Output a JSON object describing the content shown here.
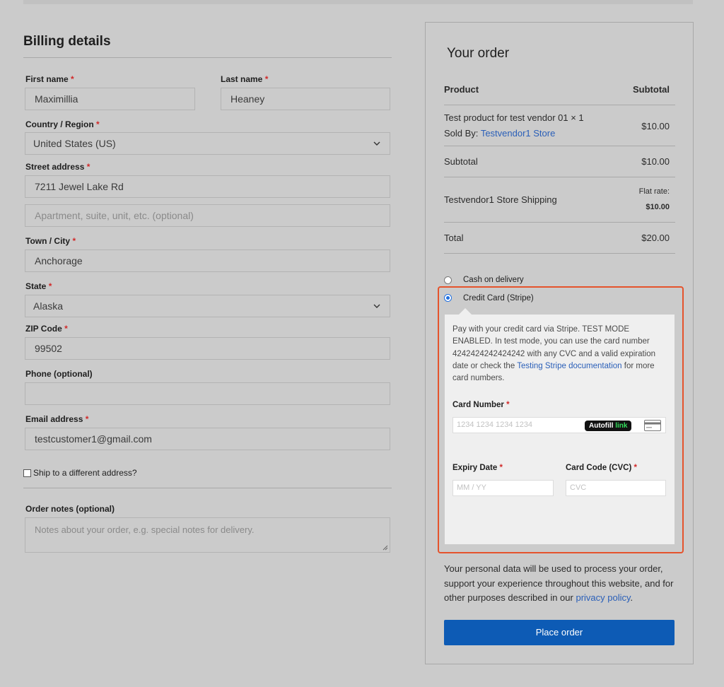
{
  "billing": {
    "title": "Billing details",
    "first_name": {
      "label": "First name",
      "value": "Maximillia"
    },
    "last_name": {
      "label": "Last name",
      "value": "Heaney"
    },
    "country": {
      "label": "Country / Region",
      "value": "United States (US)"
    },
    "street": {
      "label": "Street address",
      "value": "7211 Jewel Lake Rd",
      "placeholder2": "Apartment, suite, unit, etc. (optional)"
    },
    "city": {
      "label": "Town / City",
      "value": "Anchorage"
    },
    "state": {
      "label": "State",
      "value": "Alaska"
    },
    "zip": {
      "label": "ZIP Code",
      "value": "99502"
    },
    "phone": {
      "label": "Phone (optional)",
      "value": ""
    },
    "email": {
      "label": "Email address",
      "value": "testcustomer1@gmail.com"
    },
    "ship_different": "Ship to a different address?",
    "notes": {
      "label": "Order notes (optional)",
      "placeholder": "Notes about your order, e.g. special notes for delivery."
    },
    "required_mark": "*"
  },
  "order": {
    "title": "Your order",
    "col_product": "Product",
    "col_subtotal": "Subtotal",
    "item": {
      "name": "Test product for test vendor 01 × 1",
      "sold_by_label": "Sold By:",
      "vendor": "Testvendor1 Store",
      "price": "$10.00"
    },
    "subtotal": {
      "label": "Subtotal",
      "value": "$10.00"
    },
    "shipping": {
      "label": "Testvendor1 Store Shipping",
      "method": "Flat rate:",
      "value": "$10.00"
    },
    "total": {
      "label": "Total",
      "value": "$20.00"
    }
  },
  "payment": {
    "cod_label": "Cash on delivery",
    "stripe_label": "Credit Card (Stripe)",
    "selected": "stripe",
    "desc_pre": "Pay with your credit card via Stripe. TEST MODE ENABLED. In test mode, you can use the card number 4242424242424242 with any CVC and a valid expiration date or check the",
    "desc_link": "Testing Stripe documentation",
    "desc_post": "for more card numbers.",
    "card_number_label": "Card Number",
    "card_number_placeholder": "1234 1234 1234 1234",
    "autofill": "Autofill",
    "autofill_link": "link",
    "expiry_label": "Expiry Date",
    "expiry_placeholder": "MM / YY",
    "cvc_label": "Card Code (CVC)",
    "cvc_placeholder": "CVC"
  },
  "privacy": {
    "text": "Your personal data will be used to process your order, support your experience throughout this website, and for other purposes described in our",
    "link": "privacy policy",
    "end": "."
  },
  "place_order": "Place order",
  "colors": {
    "accent": "#0d5bb5",
    "highlight": "#e5532c",
    "link": "#2a5fb8",
    "required": "#d12a2a"
  }
}
